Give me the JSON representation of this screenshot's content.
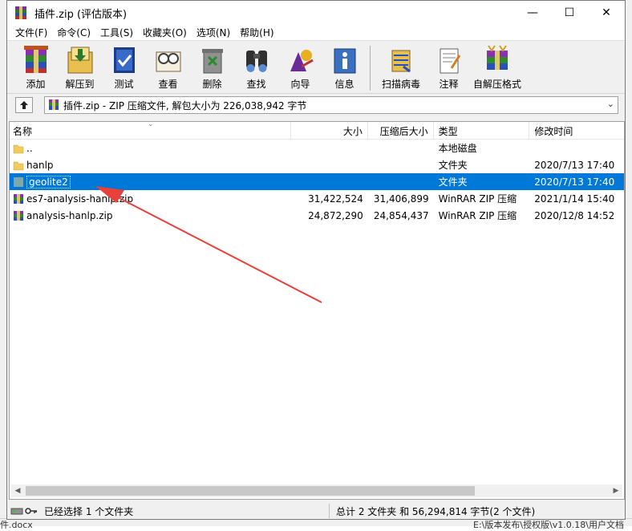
{
  "window": {
    "title": "插件.zip (评估版本)",
    "minimize": "—",
    "maximize": "☐",
    "close": "✕"
  },
  "menu": [
    "文件(F)",
    "命令(C)",
    "工具(S)",
    "收藏夹(O)",
    "选项(N)",
    "帮助(H)"
  ],
  "toolbar": [
    {
      "label": "添加",
      "icon": "add-archive-icon"
    },
    {
      "label": "解压到",
      "icon": "extract-to-icon"
    },
    {
      "label": "测试",
      "icon": "test-icon"
    },
    {
      "label": "查看",
      "icon": "view-icon"
    },
    {
      "label": "删除",
      "icon": "delete-icon"
    },
    {
      "label": "查找",
      "icon": "find-icon"
    },
    {
      "label": "向导",
      "icon": "wizard-icon"
    },
    {
      "label": "信息",
      "icon": "info-icon"
    },
    {
      "label": "扫描病毒",
      "icon": "virus-scan-icon"
    },
    {
      "label": "注释",
      "icon": "comment-icon"
    },
    {
      "label": "自解压格式",
      "icon": "sfx-icon"
    }
  ],
  "path": {
    "text": "插件.zip - ZIP 压缩文件, 解包大小为 226,038,942 字节"
  },
  "columns": {
    "name": "名称",
    "size": "大小",
    "packed": "压缩后大小",
    "type": "类型",
    "modified": "修改时间"
  },
  "files": [
    {
      "name": "..",
      "size": "",
      "packed": "",
      "type": "本地磁盘",
      "modified": "",
      "kind": "folder"
    },
    {
      "name": "hanlp",
      "size": "",
      "packed": "",
      "type": "文件夹",
      "modified": "2020/7/13 17:40",
      "kind": "folder"
    },
    {
      "name": "geolite2",
      "size": "",
      "packed": "",
      "type": "文件夹",
      "modified": "2020/7/13 17:40",
      "kind": "folder-selected"
    },
    {
      "name": "es7-analysis-hanlp.zip",
      "size": "31,422,524",
      "packed": "31,406,899",
      "type": "WinRAR ZIP 压缩",
      "modified": "2021/1/14 15:40",
      "kind": "zip"
    },
    {
      "name": "analysis-hanlp.zip",
      "size": "24,872,290",
      "packed": "24,854,437",
      "type": "WinRAR ZIP 压缩",
      "modified": "2020/12/8 14:52",
      "kind": "zip"
    }
  ],
  "status": {
    "left": "已经选择 1 个文件夹",
    "right": "总计 2 文件夹 和 56,294,814 字节(2 个文件)"
  },
  "background": {
    "bottom_left": "件.docx",
    "bottom_right": "E:\\版本发布\\授权版\\v1.0.18\\用户文档"
  },
  "annotation": {
    "color": "#e8413a"
  }
}
